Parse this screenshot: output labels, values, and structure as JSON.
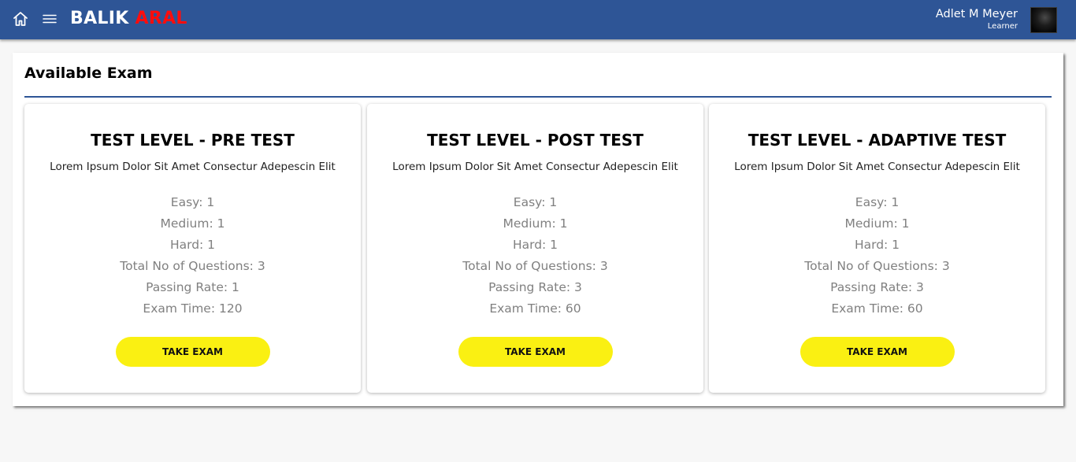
{
  "header": {
    "brand_part1": "BALIK",
    "brand_part2": "ARAL",
    "user_name": "Adlet M Meyer",
    "user_role": "Learner",
    "icons": [
      "home-icon",
      "hamburger-menu-icon"
    ],
    "colors": {
      "bar": "#2e5596",
      "brand_accent": "#ff0d0d"
    }
  },
  "main": {
    "title": "Available Exam",
    "cards": [
      {
        "title": "TEST LEVEL - PRE TEST",
        "description": "Lorem Ipsum Dolor Sit Amet Consectur Adepescin Elit",
        "stats": [
          "Easy: 1",
          "Medium: 1",
          "Hard: 1",
          "Total No of Questions: 3",
          "Passing Rate: 1",
          "Exam Time: 120"
        ],
        "button_label": "TAKE EXAM"
      },
      {
        "title": "TEST LEVEL - POST TEST",
        "description": "Lorem Ipsum Dolor Sit Amet Consectur Adepescin Elit",
        "stats": [
          "Easy: 1",
          "Medium: 1",
          "Hard: 1",
          "Total No of Questions: 3",
          "Passing Rate: 3",
          "Exam Time: 60"
        ],
        "button_label": "TAKE EXAM"
      },
      {
        "title": "TEST LEVEL - ADAPTIVE TEST",
        "description": "Lorem Ipsum Dolor Sit Amet Consectur Adepescin Elit",
        "stats": [
          "Easy: 1",
          "Medium: 1",
          "Hard: 1",
          "Total No of Questions: 3",
          "Passing Rate: 3",
          "Exam Time: 60"
        ],
        "button_label": "TAKE EXAM"
      }
    ],
    "button_color": "#faf012"
  }
}
